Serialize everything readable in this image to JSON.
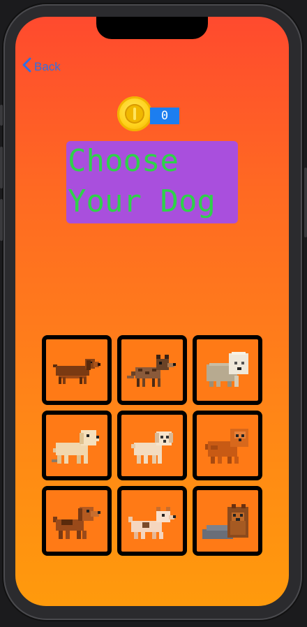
{
  "nav": {
    "back_label": "Back"
  },
  "coins": {
    "count": "0"
  },
  "title": "Choose\nYour Dog",
  "dogs": [
    {
      "name": "dachshund",
      "icon": "dachshund-icon",
      "color": "#7b3a12"
    },
    {
      "name": "german-shepherd",
      "icon": "german-shepherd-icon",
      "color": "#8a5a3a"
    },
    {
      "name": "old-english-sheepdog",
      "icon": "sheepdog-icon",
      "color": "#c9bda4"
    },
    {
      "name": "golden-retriever",
      "icon": "golden-retriever-icon",
      "color": "#f1d7ae"
    },
    {
      "name": "poodle",
      "icon": "poodle-icon",
      "color": "#f3dcc0"
    },
    {
      "name": "pomeranian",
      "icon": "pomeranian-icon",
      "color": "#c85a14"
    },
    {
      "name": "beagle",
      "icon": "beagle-icon",
      "color": "#9a4a1a"
    },
    {
      "name": "jack-russell",
      "icon": "jack-russell-icon",
      "color": "#f5d6bf"
    },
    {
      "name": "yorkshire-terrier",
      "icon": "yorkie-icon",
      "color": "#8c4a1d"
    }
  ]
}
